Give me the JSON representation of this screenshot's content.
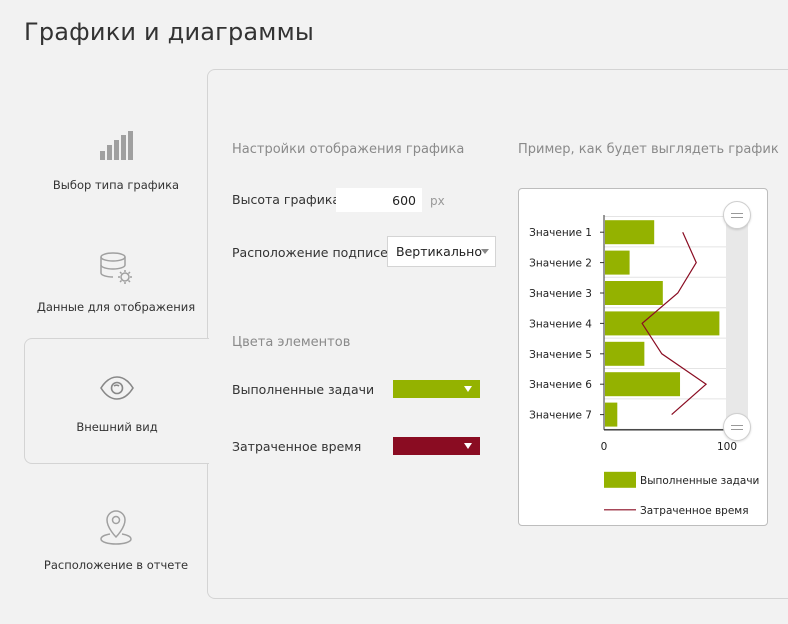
{
  "page_title": "Графики и диаграммы",
  "nav": {
    "items": [
      {
        "label": "Выбор типа графика",
        "icon": "bar-chart-icon"
      },
      {
        "label": "Данные для отображения",
        "icon": "database-settings-icon"
      },
      {
        "label": "Внешний вид",
        "icon": "eye-icon"
      },
      {
        "label": "Расположение в отчете",
        "icon": "map-pin-icon"
      }
    ],
    "active_index": 2
  },
  "settings": {
    "title": "Настройки отображения графика",
    "height_label": "Высота графика",
    "height_value": "600",
    "height_unit": "px",
    "labels_position_label": "Расположение подписей",
    "labels_position_value": "Вертикально"
  },
  "colors": {
    "title": "Цвета элементов",
    "completed_label": "Выполненные задачи",
    "completed_color": "#94b200",
    "time_label": "Затраченное время",
    "time_color": "#8a0c22"
  },
  "preview": {
    "title": "Пример, как будет выглядеть график"
  },
  "chart_data": {
    "type": "bar",
    "orientation": "horizontal",
    "categories": [
      "Значение 1",
      "Значение 2",
      "Значение 3",
      "Значение 4",
      "Значение 5",
      "Значение 6",
      "Значение 7"
    ],
    "series": [
      {
        "name": "Выполненные задачи",
        "type": "bar",
        "color": "#94b200",
        "values": [
          40,
          20,
          47,
          93,
          32,
          61,
          10
        ]
      },
      {
        "name": "Затраченное время",
        "type": "line",
        "color": "#8a0c22",
        "values": [
          64,
          75,
          60,
          31,
          47,
          83,
          55
        ]
      }
    ],
    "xlim": [
      0,
      100
    ],
    "x_ticks": [
      "0",
      "100"
    ],
    "grid": true,
    "legend_position": "bottom"
  }
}
